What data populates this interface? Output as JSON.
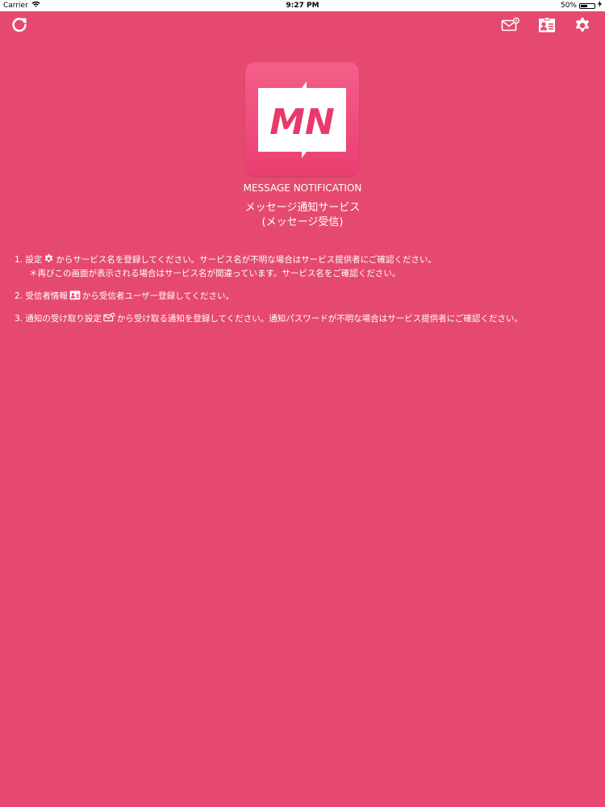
{
  "status_bar": {
    "carrier": "Carrier",
    "time": "9:27 PM",
    "battery": "50%",
    "battery_level": 0.5
  },
  "nav_bar": {
    "refresh_icon": "refresh-icon",
    "mail_settings_icon": "mail-settings-icon",
    "contact_card_icon": "contact-card-icon",
    "settings_icon": "gear-icon"
  },
  "logo": {
    "letters": "MN",
    "colors": {
      "background": "#e6496f",
      "logo_pink": "#e83a6a"
    }
  },
  "app": {
    "name": "MESSAGE NOTIFICATION",
    "title_line1": "メッセージ通知サービス",
    "title_line2": "(メッセージ受信)"
  },
  "instructions": {
    "step1_before": "1. 設定",
    "step1_after": "からサービス名を登録してください。サービス名が不明な場合はサービス提供者にご確認ください。",
    "step1_note": "＊再びこの画面が表示される場合はサービス名が間違っています。サービス名をご確認ください。",
    "step2_before": "2. 受信者情報",
    "step2_after": "から受信者ユーザー登録してください。",
    "step3_before": "3. 通知の受け取り設定",
    "step3_after": "から受け取る通知を登録してください。通知パスワードが不明な場合はサービス提供者にご確認ください。"
  }
}
